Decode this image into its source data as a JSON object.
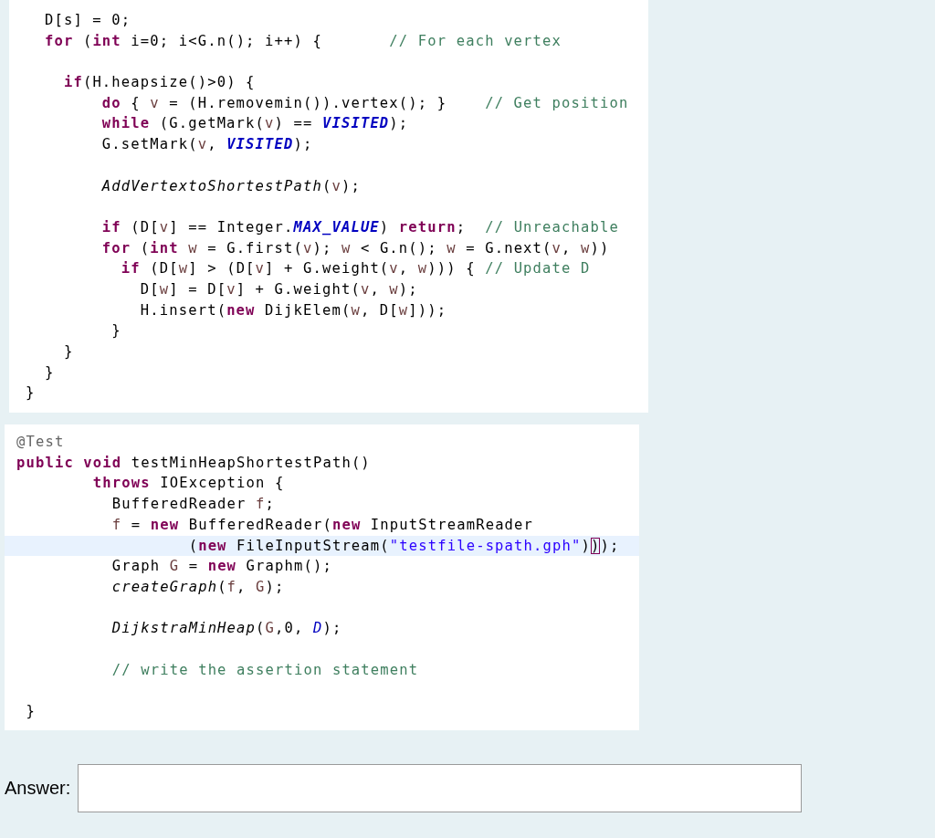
{
  "code_panels": [
    {
      "lines": [
        {
          "current": false,
          "tokens": [
            {
              "kind": "plain",
              "text": "  D[s] = 0;"
            }
          ]
        },
        {
          "current": false,
          "tokens": [
            {
              "kind": "kw",
              "text": "  for"
            },
            {
              "kind": "plain",
              "text": " ("
            },
            {
              "kind": "kw",
              "text": "int"
            },
            {
              "kind": "plain",
              "text": " i=0; i<G.n(); i++) {       "
            },
            {
              "kind": "comment",
              "text": "// For each vertex"
            }
          ]
        },
        {
          "current": false,
          "blank_before": true,
          "tokens": [
            {
              "kind": "kw",
              "text": "    if"
            },
            {
              "kind": "plain",
              "text": "(H.heapsize()>0) {"
            }
          ]
        },
        {
          "current": false,
          "tokens": [
            {
              "kind": "kw",
              "text": "        do"
            },
            {
              "kind": "plain",
              "text": " { "
            },
            {
              "kind": "local",
              "text": "v"
            },
            {
              "kind": "plain",
              "text": " = (H.removemin()).vertex(); }    "
            },
            {
              "kind": "comment",
              "text": "// Get position"
            }
          ]
        },
        {
          "current": false,
          "tokens": [
            {
              "kind": "kw",
              "text": "        while"
            },
            {
              "kind": "plain",
              "text": " (G.getMark("
            },
            {
              "kind": "local",
              "text": "v"
            },
            {
              "kind": "plain",
              "text": ") == "
            },
            {
              "kind": "const",
              "text": "VISITED"
            },
            {
              "kind": "plain",
              "text": ");"
            }
          ]
        },
        {
          "current": false,
          "tokens": [
            {
              "kind": "plain",
              "text": "        G.setMark("
            },
            {
              "kind": "local",
              "text": "v"
            },
            {
              "kind": "plain",
              "text": ", "
            },
            {
              "kind": "const",
              "text": "VISITED"
            },
            {
              "kind": "plain",
              "text": ");"
            }
          ]
        },
        {
          "current": false,
          "blank_before": true,
          "tokens": [
            {
              "kind": "method",
              "text": "        AddVertextoShortestPath"
            },
            {
              "kind": "plain",
              "text": "("
            },
            {
              "kind": "local",
              "text": "v"
            },
            {
              "kind": "plain",
              "text": ");"
            }
          ]
        },
        {
          "current": false,
          "blank_before": true,
          "tokens": [
            {
              "kind": "kw",
              "text": "        if"
            },
            {
              "kind": "plain",
              "text": " (D["
            },
            {
              "kind": "local",
              "text": "v"
            },
            {
              "kind": "plain",
              "text": "] == Integer."
            },
            {
              "kind": "const",
              "text": "MAX_VALUE"
            },
            {
              "kind": "plain",
              "text": ") "
            },
            {
              "kind": "kw",
              "text": "return"
            },
            {
              "kind": "plain",
              "text": ";  "
            },
            {
              "kind": "comment",
              "text": "// Unreachable"
            }
          ]
        },
        {
          "current": false,
          "tokens": [
            {
              "kind": "kw",
              "text": "        for"
            },
            {
              "kind": "plain",
              "text": " ("
            },
            {
              "kind": "kw",
              "text": "int "
            },
            {
              "kind": "local",
              "text": "w"
            },
            {
              "kind": "plain",
              "text": " = G.first("
            },
            {
              "kind": "local",
              "text": "v"
            },
            {
              "kind": "plain",
              "text": "); "
            },
            {
              "kind": "local",
              "text": "w"
            },
            {
              "kind": "plain",
              "text": " < G.n(); "
            },
            {
              "kind": "local",
              "text": "w"
            },
            {
              "kind": "plain",
              "text": " = G.next("
            },
            {
              "kind": "local",
              "text": "v"
            },
            {
              "kind": "plain",
              "text": ", "
            },
            {
              "kind": "local",
              "text": "w"
            },
            {
              "kind": "plain",
              "text": "))"
            }
          ]
        },
        {
          "current": false,
          "tokens": [
            {
              "kind": "kw",
              "text": "          if"
            },
            {
              "kind": "plain",
              "text": " (D["
            },
            {
              "kind": "local",
              "text": "w"
            },
            {
              "kind": "plain",
              "text": "] > (D["
            },
            {
              "kind": "local",
              "text": "v"
            },
            {
              "kind": "plain",
              "text": "] + G.weight("
            },
            {
              "kind": "local",
              "text": "v"
            },
            {
              "kind": "plain",
              "text": ", "
            },
            {
              "kind": "local",
              "text": "w"
            },
            {
              "kind": "plain",
              "text": "))) { "
            },
            {
              "kind": "comment",
              "text": "// Update D"
            }
          ]
        },
        {
          "current": false,
          "tokens": [
            {
              "kind": "plain",
              "text": "            D["
            },
            {
              "kind": "local",
              "text": "w"
            },
            {
              "kind": "plain",
              "text": "] = D["
            },
            {
              "kind": "local",
              "text": "v"
            },
            {
              "kind": "plain",
              "text": "] + G.weight("
            },
            {
              "kind": "local",
              "text": "v"
            },
            {
              "kind": "plain",
              "text": ", "
            },
            {
              "kind": "local",
              "text": "w"
            },
            {
              "kind": "plain",
              "text": ");"
            }
          ]
        },
        {
          "current": false,
          "tokens": [
            {
              "kind": "plain",
              "text": "            H.insert("
            },
            {
              "kind": "kw",
              "text": "new"
            },
            {
              "kind": "plain",
              "text": " DijkElem("
            },
            {
              "kind": "local",
              "text": "w"
            },
            {
              "kind": "plain",
              "text": ", D["
            },
            {
              "kind": "local",
              "text": "w"
            },
            {
              "kind": "plain",
              "text": "]));"
            }
          ]
        },
        {
          "current": false,
          "tokens": [
            {
              "kind": "plain",
              "text": "         }"
            }
          ]
        },
        {
          "current": false,
          "tokens": [
            {
              "kind": "plain",
              "text": "    }"
            }
          ]
        },
        {
          "current": false,
          "tokens": [
            {
              "kind": "plain",
              "text": "  }"
            }
          ]
        },
        {
          "current": false,
          "tokens": [
            {
              "kind": "plain",
              "text": "}"
            }
          ]
        }
      ]
    },
    {
      "lines": [
        {
          "current": false,
          "tokens": [
            {
              "kind": "annotation",
              "text": "@Test"
            }
          ]
        },
        {
          "current": false,
          "tokens": [
            {
              "kind": "kw",
              "text": "public void"
            },
            {
              "kind": "plain",
              "text": " testMinHeapShortestPath()"
            }
          ]
        },
        {
          "current": false,
          "tokens": [
            {
              "kind": "kw",
              "text": "        throws"
            },
            {
              "kind": "plain",
              "text": " IOException {"
            }
          ]
        },
        {
          "current": false,
          "tokens": [
            {
              "kind": "plain",
              "text": "          BufferedReader "
            },
            {
              "kind": "local",
              "text": "f"
            },
            {
              "kind": "plain",
              "text": ";"
            }
          ]
        },
        {
          "current": false,
          "tokens": [
            {
              "kind": "local",
              "text": "          f"
            },
            {
              "kind": "plain",
              "text": " = "
            },
            {
              "kind": "kw",
              "text": "new"
            },
            {
              "kind": "plain",
              "text": " BufferedReader("
            },
            {
              "kind": "kw",
              "text": "new"
            },
            {
              "kind": "plain",
              "text": " InputStreamReader"
            }
          ]
        },
        {
          "current": true,
          "tokens": [
            {
              "kind": "plain",
              "text": "                  ("
            },
            {
              "kind": "kw",
              "text": "new"
            },
            {
              "kind": "plain",
              "text": " FileInputStream("
            },
            {
              "kind": "string",
              "text": "\"testfile-spath.gph\""
            },
            {
              "kind": "plain",
              "text": ")"
            },
            {
              "kind": "bracket",
              "text": ")"
            },
            {
              "kind": "plain",
              "text": ");"
            }
          ]
        },
        {
          "current": false,
          "tokens": [
            {
              "kind": "plain",
              "text": "          Graph "
            },
            {
              "kind": "local",
              "text": "G"
            },
            {
              "kind": "plain",
              "text": " = "
            },
            {
              "kind": "kw",
              "text": "new"
            },
            {
              "kind": "plain",
              "text": " Graphm();"
            }
          ]
        },
        {
          "current": false,
          "tokens": [
            {
              "kind": "method",
              "text": "          createGraph"
            },
            {
              "kind": "plain",
              "text": "("
            },
            {
              "kind": "local",
              "text": "f"
            },
            {
              "kind": "plain",
              "text": ", "
            },
            {
              "kind": "local",
              "text": "G"
            },
            {
              "kind": "plain",
              "text": ");"
            }
          ]
        },
        {
          "current": false,
          "blank_before": true,
          "tokens": [
            {
              "kind": "method",
              "text": "          DijkstraMinHeap"
            },
            {
              "kind": "plain",
              "text": "("
            },
            {
              "kind": "local",
              "text": "G"
            },
            {
              "kind": "plain",
              "text": ",0, "
            },
            {
              "kind": "field",
              "text": "D"
            },
            {
              "kind": "plain",
              "text": ");"
            }
          ]
        },
        {
          "current": false,
          "blank_before": true,
          "tokens": [
            {
              "kind": "comment",
              "text": "          // write the assertion statement"
            }
          ]
        },
        {
          "current": false,
          "blank_before": true,
          "tokens": [
            {
              "kind": "plain",
              "text": " }"
            }
          ]
        }
      ]
    }
  ],
  "answer": {
    "label": "Answer:"
  }
}
